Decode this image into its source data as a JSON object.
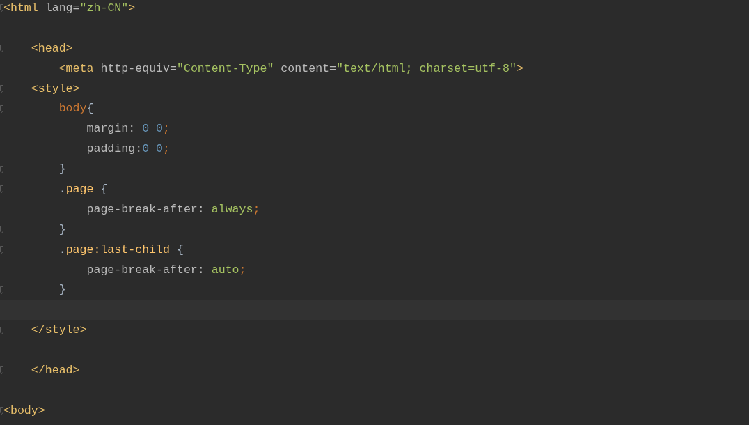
{
  "editor": {
    "lines": [
      {
        "kind": "line",
        "fold": true,
        "tokens": [
          {
            "kind": "tag",
            "text": "<html "
          },
          {
            "kind": "attr",
            "text": "lang="
          },
          {
            "kind": "string",
            "text": "\"zh-CN\""
          },
          {
            "kind": "tag",
            "text": ">"
          }
        ]
      },
      {
        "kind": "line",
        "fold": false
      },
      {
        "kind": "line",
        "fold": true,
        "tokens": [
          {
            "kind": "tag",
            "text": "    <head>"
          }
        ]
      },
      {
        "kind": "line",
        "fold": false,
        "tokens": [
          {
            "kind": "tag",
            "text": "        <meta "
          },
          {
            "kind": "attr",
            "text": "http-equiv="
          },
          {
            "kind": "string",
            "text": "\"Content-Type\""
          },
          {
            "kind": "attr",
            "text": " content="
          },
          {
            "kind": "string",
            "text": "\"text/html; charset=utf-8\""
          },
          {
            "kind": "tag",
            "text": ">"
          }
        ]
      },
      {
        "kind": "line",
        "fold": true,
        "tokens": [
          {
            "kind": "tag",
            "text": "    <style>"
          }
        ]
      },
      {
        "kind": "line",
        "fold": true,
        "tokens": [
          {
            "kind": "element",
            "text": "        body"
          },
          {
            "kind": "punct",
            "text": "{"
          }
        ]
      },
      {
        "kind": "line",
        "fold": false,
        "tokens": [
          {
            "kind": "prop",
            "text": "            margin: "
          },
          {
            "kind": "number",
            "text": "0 0"
          },
          {
            "kind": "semi",
            "text": ";"
          }
        ]
      },
      {
        "kind": "line",
        "fold": false,
        "tokens": [
          {
            "kind": "prop",
            "text": "            padding:"
          },
          {
            "kind": "number",
            "text": "0 0"
          },
          {
            "kind": "semi",
            "text": ";"
          }
        ]
      },
      {
        "kind": "line",
        "fold": true,
        "tokens": [
          {
            "kind": "punct",
            "text": "        }"
          }
        ]
      },
      {
        "kind": "line",
        "fold": true,
        "tokens": [
          {
            "kind": "punct",
            "text": "        ."
          },
          {
            "kind": "class",
            "text": "page"
          },
          {
            "kind": "punct",
            "text": " {"
          }
        ]
      },
      {
        "kind": "line",
        "fold": false,
        "tokens": [
          {
            "kind": "prop",
            "text": "            page-break-after: "
          },
          {
            "kind": "value",
            "text": "always"
          },
          {
            "kind": "semi",
            "text": ";"
          }
        ]
      },
      {
        "kind": "line",
        "fold": true,
        "tokens": [
          {
            "kind": "punct",
            "text": "        }"
          }
        ]
      },
      {
        "kind": "line",
        "fold": true,
        "tokens": [
          {
            "kind": "punct",
            "text": "        ."
          },
          {
            "kind": "class",
            "text": "page:last-child"
          },
          {
            "kind": "punct",
            "text": " {"
          }
        ]
      },
      {
        "kind": "line",
        "fold": false,
        "tokens": [
          {
            "kind": "prop",
            "text": "            page-break-after: "
          },
          {
            "kind": "value",
            "text": "auto"
          },
          {
            "kind": "semi",
            "text": ";"
          }
        ]
      },
      {
        "kind": "line",
        "fold": true,
        "tokens": [
          {
            "kind": "punct",
            "text": "        }"
          }
        ]
      },
      {
        "kind": "caret-line",
        "fold": false
      },
      {
        "kind": "line",
        "fold": true,
        "tokens": [
          {
            "kind": "tag",
            "text": "    </style>"
          }
        ]
      },
      {
        "kind": "line",
        "fold": false
      },
      {
        "kind": "line",
        "fold": true,
        "tokens": [
          {
            "kind": "tag",
            "text": "    </head>"
          }
        ]
      },
      {
        "kind": "line",
        "fold": false
      },
      {
        "kind": "line",
        "fold": true,
        "tokens": [
          {
            "kind": "tag",
            "text": "<body>"
          }
        ]
      }
    ]
  }
}
